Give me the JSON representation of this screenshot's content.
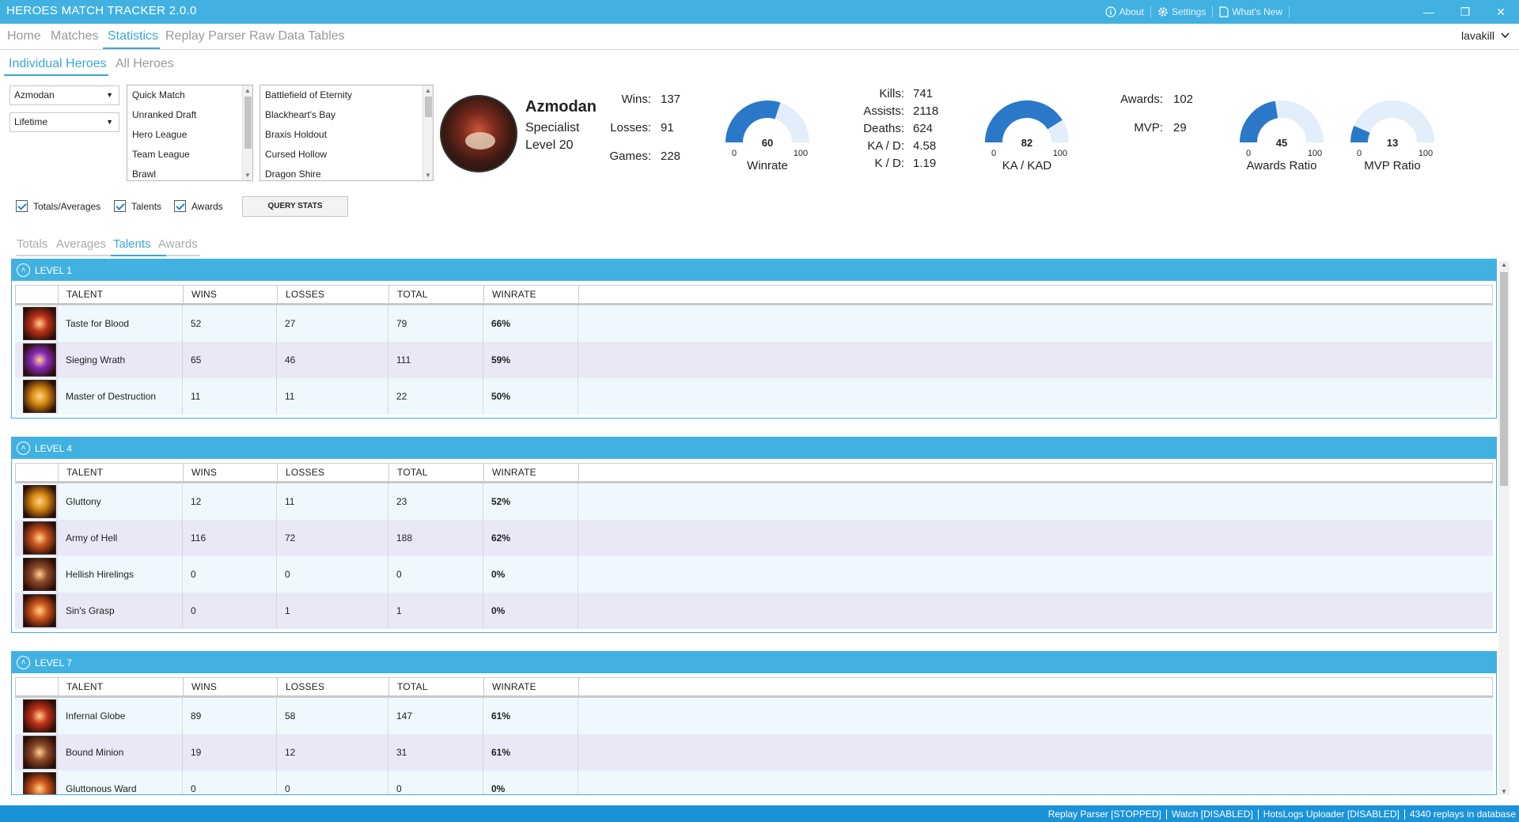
{
  "titlebar": {
    "title": "HEROES MATCH TRACKER 2.0.0",
    "about": "About",
    "settings": "Settings",
    "whats_new": "What's New"
  },
  "nav": {
    "tabs": [
      "Home",
      "Matches",
      "Statistics",
      "Replay Parser",
      "Raw Data Tables"
    ],
    "active": "Statistics",
    "user": "lavakill"
  },
  "subnav": {
    "tabs": [
      "Individual Heroes",
      "All Heroes"
    ],
    "active": "Individual Heroes"
  },
  "filters": {
    "hero": "Azmodan",
    "season": "Lifetime",
    "game_modes": [
      "Quick Match",
      "Unranked Draft",
      "Hero League",
      "Team League",
      "Brawl"
    ],
    "maps": [
      "Battlefield of Eternity",
      "Blackheart's Bay",
      "Braxis Holdout",
      "Cursed Hollow",
      "Dragon Shire"
    ],
    "checkboxes": {
      "totals": "Totals/Averages",
      "talents": "Talents",
      "awards": "Awards"
    },
    "query_button": "QUERY STATS"
  },
  "hero": {
    "name": "Azmodan",
    "role": "Specialist",
    "level": "Level 20",
    "labels": {
      "wins": "Wins:",
      "losses": "Losses:",
      "games": "Games:",
      "kills": "Kills:",
      "assists": "Assists:",
      "deaths": "Deaths:",
      "ka_d": "KA / D:",
      "k_d": "K / D:",
      "awards": "Awards:",
      "mvp": "MVP:"
    },
    "values": {
      "wins": "137",
      "losses": "91",
      "games": "228",
      "kills": "741",
      "assists": "2118",
      "deaths": "624",
      "ka_d": "4.58",
      "k_d": "1.19",
      "awards": "102",
      "mvp": "29"
    }
  },
  "gauges": [
    {
      "label": "Winrate",
      "value": 60,
      "min": "0",
      "max": "100",
      "value_text": "60"
    },
    {
      "label": "KA / KAD",
      "value": 82,
      "min": "0",
      "max": "100",
      "value_text": "82"
    },
    {
      "label": "Awards Ratio",
      "value": 45,
      "min": "0",
      "max": "100",
      "value_text": "45"
    },
    {
      "label": "MVP Ratio",
      "value": 13,
      "min": "0",
      "max": "100",
      "value_text": "13"
    }
  ],
  "stat_tabs": {
    "tabs": [
      "Totals",
      "Averages",
      "Talents",
      "Awards"
    ],
    "active": "Talents"
  },
  "columns": [
    "TALENT",
    "WINS",
    "LOSSES",
    "TOTAL",
    "WINRATE"
  ],
  "levels": [
    {
      "title": "LEVEL 1",
      "rows": [
        {
          "talent": "Taste for Blood",
          "wins": "52",
          "losses": "27",
          "total": "79",
          "winrate": "66%",
          "icon": "blood-orb-icon",
          "color": "#c2331a"
        },
        {
          "talent": "Sieging Wrath",
          "wins": "65",
          "losses": "46",
          "total": "111",
          "winrate": "59%",
          "icon": "purple-orb-icon",
          "color": "#8a2bbd"
        },
        {
          "talent": "Master of Destruction",
          "wins": "11",
          "losses": "11",
          "total": "22",
          "winrate": "50%",
          "icon": "claw-fire-icon",
          "color": "#d88b12"
        }
      ]
    },
    {
      "title": "LEVEL 4",
      "rows": [
        {
          "talent": "Gluttony",
          "wins": "12",
          "losses": "11",
          "total": "23",
          "winrate": "52%",
          "icon": "claw-fire-icon",
          "color": "#d88b12"
        },
        {
          "talent": "Army of Hell",
          "wins": "116",
          "losses": "72",
          "total": "188",
          "winrate": "62%",
          "icon": "demon-army-icon",
          "color": "#c9521e"
        },
        {
          "talent": "Hellish Hirelings",
          "wins": "0",
          "losses": "0",
          "total": "0",
          "winrate": "0%",
          "icon": "demon-minion-icon",
          "color": "#8d4a2a"
        },
        {
          "talent": "Sin's Grasp",
          "wins": "0",
          "losses": "1",
          "total": "1",
          "winrate": "0%",
          "icon": "demon-fist-icon",
          "color": "#d0561c"
        }
      ]
    },
    {
      "title": "LEVEL 7",
      "rows": [
        {
          "talent": "Infernal Globe",
          "wins": "89",
          "losses": "58",
          "total": "147",
          "winrate": "61%",
          "icon": "blood-orb-icon",
          "color": "#c2331a"
        },
        {
          "talent": "Bound Minion",
          "wins": "19",
          "losses": "12",
          "total": "31",
          "winrate": "61%",
          "icon": "demon-minion-icon",
          "color": "#8d4a2a"
        },
        {
          "talent": "Gluttonous Ward",
          "wins": "0",
          "losses": "0",
          "total": "0",
          "winrate": "0%",
          "icon": "demon-fist-icon",
          "color": "#d0561c"
        }
      ]
    }
  ],
  "status": [
    "Replay Parser [STOPPED]",
    "Watch [DISABLED]",
    "HotsLogs Uploader [DISABLED]",
    "4340  replays in database"
  ],
  "colors": {
    "accent": "#41b1e1",
    "gauge_fill": "#2b78c8",
    "gauge_track": "#e2eef9",
    "status_bar": "#1b93d8"
  }
}
